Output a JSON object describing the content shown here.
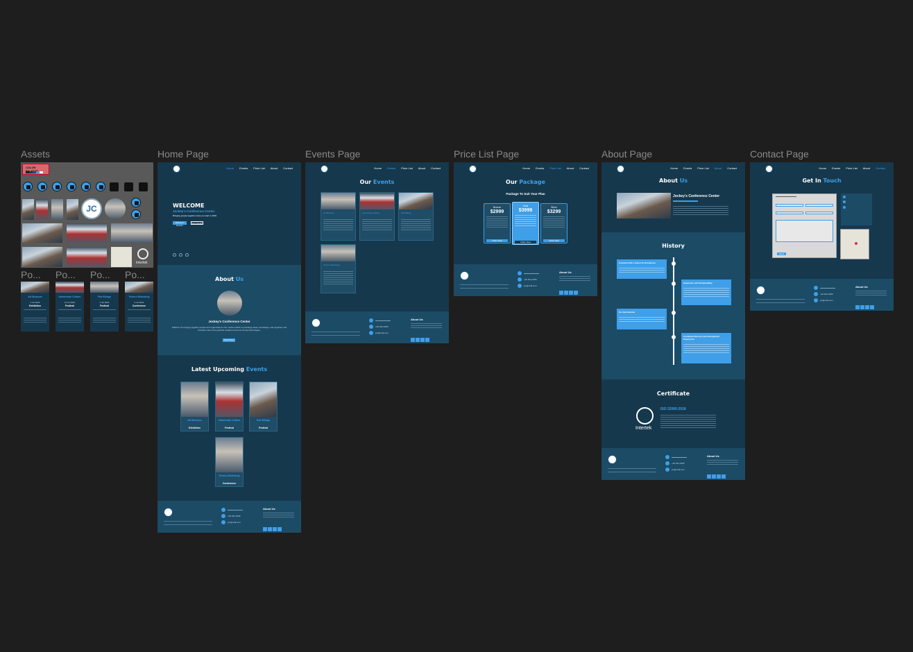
{
  "labels": {
    "assets": "Assets",
    "home": "Home Page",
    "events": "Events Page",
    "price": "Price List Page",
    "about": "About Page",
    "contact": "Contact Page"
  },
  "nav": {
    "home": "Home",
    "events": "Events",
    "price": "Price List",
    "about": "About",
    "contact": "Contact"
  },
  "assets": {
    "palette": "COLOR PALETTE",
    "intertek": "Intertek",
    "po_labels": [
      "Po...",
      "Po...",
      "Po...",
      "Po..."
    ],
    "cards": [
      {
        "name": "Art Museum",
        "date": "4 Jul 2024",
        "type": "Exhibition"
      },
      {
        "name": "Indonesian Culture",
        "date": "11 Jul 2024",
        "type": "Festival"
      },
      {
        "name": "Fair Bilingo",
        "date": "3 Jul 2024",
        "type": "Festival"
      },
      {
        "name": "Techno Workshop",
        "date": "6 Jul 2024",
        "type": "Conference"
      }
    ]
  },
  "home": {
    "welcome": "WELCOME",
    "sub": "Jockey's Conference Center",
    "small": "Bringing people together since our start in 2004",
    "btn1": "Discover Events",
    "btn2": "See Details",
    "about_title": "About",
    "about_hl": "Us",
    "center_name": "Jockey's Conference Center",
    "about_text": "Platform for bringing together people and organizations from various fields to exchange ideas, knowledge, and expertise and transform them into practical solutions and new strong technologies.",
    "read_more": "Read More",
    "latest_title": "Latest Upcoming",
    "latest_hl": "Events",
    "events": [
      {
        "name": "Art Museum",
        "date": "4 Jul 2024",
        "type": "Exhibition"
      },
      {
        "name": "Indonesian Culture",
        "date": "11 Jul 2024",
        "type": "Festival"
      },
      {
        "name": "Fair Bilingo",
        "date": "3 Jul 2024",
        "type": "Festival"
      },
      {
        "name": "Techno Workshop",
        "date": "6 Jul 2024",
        "type": "Conference"
      }
    ]
  },
  "events_page": {
    "title": "Our",
    "hl": "Events",
    "cards": [
      "Art Museum",
      "Indonesian Culture",
      "Fair Bilingo",
      "Techno Workshop"
    ]
  },
  "price": {
    "title": "Our",
    "hl": "Package",
    "sub": "Package To Suit Your Plan",
    "plans": [
      {
        "name": "Bronze",
        "price": "$2999",
        "btn": "Order Now"
      },
      {
        "name": "Gold",
        "price": "$3999",
        "btn": "Order Now"
      },
      {
        "name": "Silver",
        "price": "$3299",
        "btn": "Order Now"
      }
    ]
  },
  "about_page": {
    "title": "About",
    "hl": "Us",
    "center": "Jockey's Conference Center",
    "history": "History",
    "timeline": [
      "Founded with a Vision for Excellence",
      "Expansion and Sustainability",
      "Go International",
      "Continued Success and Exceptional Experience"
    ],
    "certificate": "Certificate",
    "iso": "ISO 22000:2018",
    "intertek": "Intertek"
  },
  "contact_page": {
    "title": "Get In",
    "hl": "Touch",
    "send": "Send"
  },
  "footer": {
    "about": "About Us",
    "phone": "+62 812-3456",
    "email": "jcc@mail.com"
  }
}
